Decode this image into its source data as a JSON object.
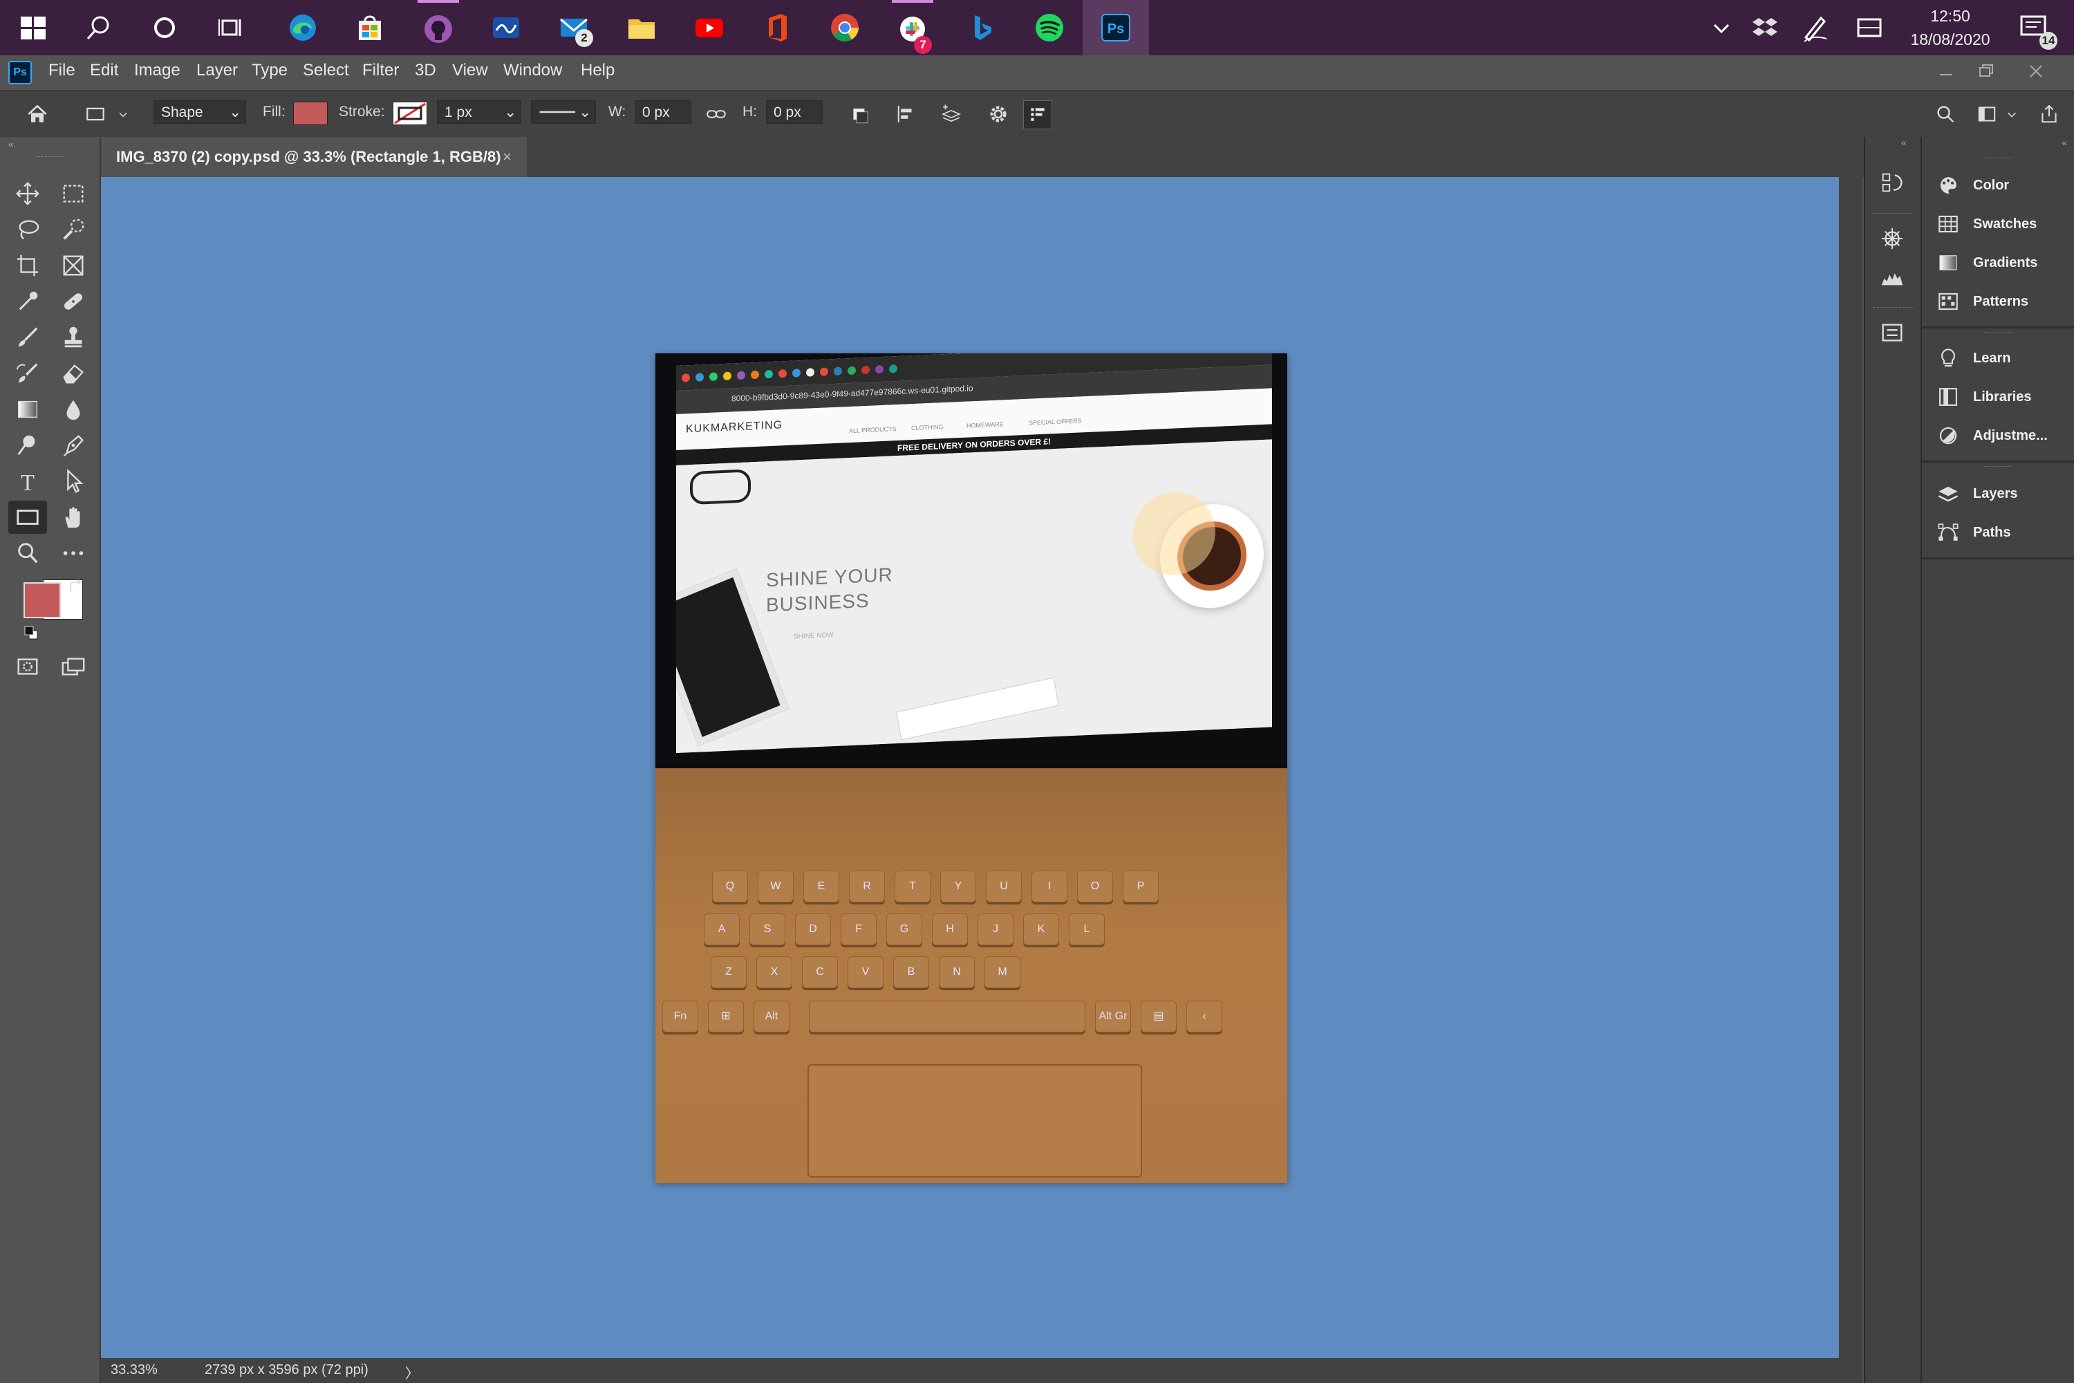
{
  "taskbar": {
    "clock_time": "12:50",
    "clock_date": "18/08/2020",
    "mail_badge": "2",
    "slack_badge": "7",
    "notification_count": "14",
    "apps": [
      "start",
      "search",
      "cortana",
      "task-view",
      "edge",
      "store",
      "github",
      "whiteboard",
      "mail",
      "explorer",
      "youtube",
      "office",
      "chrome",
      "slack",
      "bing",
      "spotify",
      "photoshop"
    ]
  },
  "menubar": {
    "app_badge": "Ps",
    "items": [
      "File",
      "Edit",
      "Image",
      "Layer",
      "Type",
      "Select",
      "Filter",
      "3D",
      "View",
      "Window",
      "Help"
    ]
  },
  "options": {
    "shape_mode": "Shape",
    "fill_label": "Fill:",
    "fill_color": "#c45a5a",
    "stroke_label": "Stroke:",
    "stroke_width": "1 px",
    "width_label": "W:",
    "width_value": "0 px",
    "height_label": "H:",
    "height_value": "0 px"
  },
  "document": {
    "tab_title": "IMG_8370 (2) copy.psd @ 33.3% (Rectangle 1, RGB/8)",
    "close_glyph": "×",
    "canvas_color": "#5f8cc0"
  },
  "photo": {
    "url": "8000-b9fbd3d0-9c89-43e0-9f49-ad477e97866c.ws-eu01.gitpod.io",
    "brand": "KUKMARKETING",
    "nav": [
      "ALL PRODUCTS",
      "CLOTHING",
      "HOMEWARE",
      "SPECIAL OFFERS"
    ],
    "banner": "FREE DELIVERY ON ORDERS OVER £!",
    "hero_line1": "SHINE YOUR",
    "hero_line2": "BUSINESS",
    "cta": "SHINE NOW",
    "key_rows": [
      [
        "Q",
        "W",
        "E",
        "R",
        "T",
        "Y",
        "U",
        "I",
        "O",
        "P"
      ],
      [
        "A",
        "S",
        "D",
        "F",
        "G",
        "H",
        "J",
        "K",
        "L"
      ],
      [
        "Z",
        "X",
        "C",
        "V",
        "B",
        "N",
        "M"
      ]
    ],
    "bottom_keys": [
      "Fn",
      "Alt",
      "Alt Gr"
    ]
  },
  "status": {
    "zoom": "33.33%",
    "doc_info": "2739 px x 3596 px (72 ppi)",
    "arrow": "〉"
  },
  "tools": [
    "move-tool",
    "rectangular-marquee-tool",
    "lasso-tool",
    "quick-selection-tool",
    "crop-tool",
    "frame-tool",
    "eyedropper-tool",
    "healing-brush-tool",
    "brush-tool",
    "clone-stamp-tool",
    "history-brush-tool",
    "eraser-tool",
    "gradient-tool",
    "blur-tool",
    "dodge-tool",
    "pen-tool",
    "type-tool",
    "path-selection-tool",
    "rectangle-tool",
    "hand-tool",
    "zoom-tool",
    "more-tools"
  ],
  "colors": {
    "foreground": "#c45a5a",
    "background": "#ffffff"
  },
  "panels": [
    "Color",
    "Swatches",
    "Gradients",
    "Patterns",
    "Learn",
    "Libraries",
    "Adjustme...",
    "Layers",
    "Paths"
  ]
}
